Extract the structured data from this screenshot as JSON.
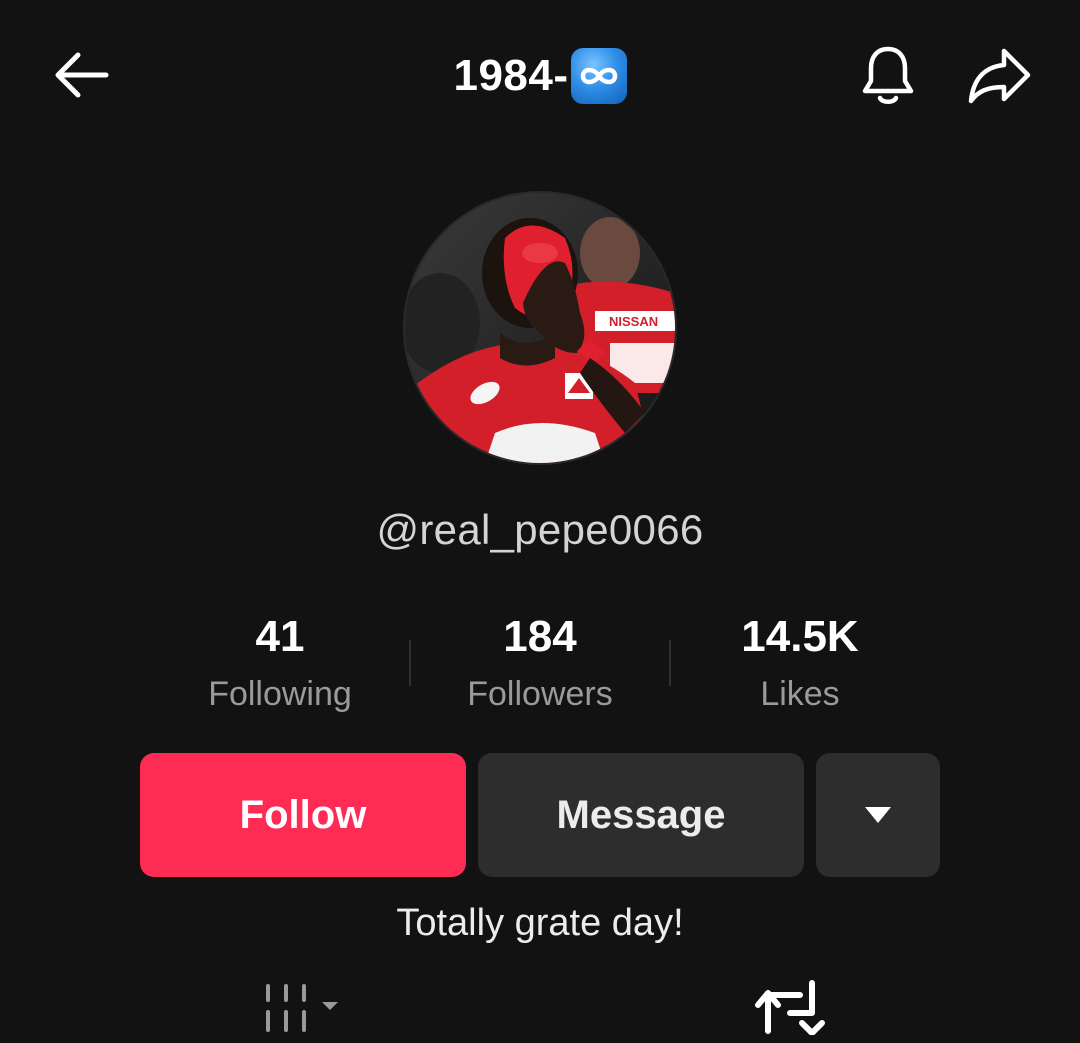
{
  "header": {
    "title": "1984-",
    "title_badge_icon": "infinity-icon",
    "badge_color": "#2f8fe8",
    "back_icon": "arrow-left-icon",
    "notification_icon": "bell-icon",
    "share_icon": "share-arrow-icon"
  },
  "profile": {
    "avatar_icon": "profile-photo",
    "username": "@real_pepe0066",
    "bio": "Totally grate day!"
  },
  "stats": [
    {
      "value": "41",
      "label": "Following"
    },
    {
      "value": "184",
      "label": "Followers"
    },
    {
      "value": "14.5K",
      "label": "Likes"
    }
  ],
  "actions": {
    "follow_label": "Follow",
    "message_label": "Message",
    "more_icon": "caret-down-icon",
    "follow_color": "#fe2c55"
  },
  "tabs": {
    "videos_icon": "grid-icon",
    "reposts_icon": "repost-icon"
  }
}
